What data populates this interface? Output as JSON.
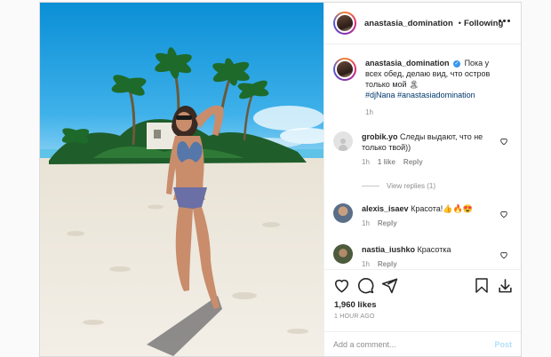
{
  "post": {
    "username": "anastasia_domination",
    "separator": "•",
    "follow_status": "Following",
    "caption": {
      "username": "anastasia_domination",
      "text": "Пока у всех обед, делаю вид, что остров только мой",
      "emoji": "🏝",
      "hashtags": "#djNana #anastasiadomination",
      "time": "1h"
    },
    "comments": [
      {
        "username": "grobik.yo",
        "text": "Следы выдают, что не только твой))",
        "time": "1h",
        "likes": "1 like",
        "reply": "Reply",
        "avatar_color": "#e0e0e0"
      },
      {
        "username": "alexis_isaev",
        "text": "Красота!👍🔥😍",
        "time": "1h",
        "reply": "Reply",
        "avatar_color": "#5b6e88"
      },
      {
        "username": "nastia_iushko",
        "text": "Красотка",
        "time": "1h",
        "reply": "Reply",
        "avatar_color": "#4d5a3c"
      }
    ],
    "view_replies": "View replies (1)",
    "likes": "1,960 likes",
    "timestamp": "1 HOUR AGO",
    "add_comment_placeholder": "Add a comment...",
    "post_button": "Post",
    "icons": [
      "heart-icon",
      "comment-icon",
      "share-icon",
      "bookmark-icon",
      "download-icon",
      "more-icon",
      "verified-icon"
    ]
  }
}
